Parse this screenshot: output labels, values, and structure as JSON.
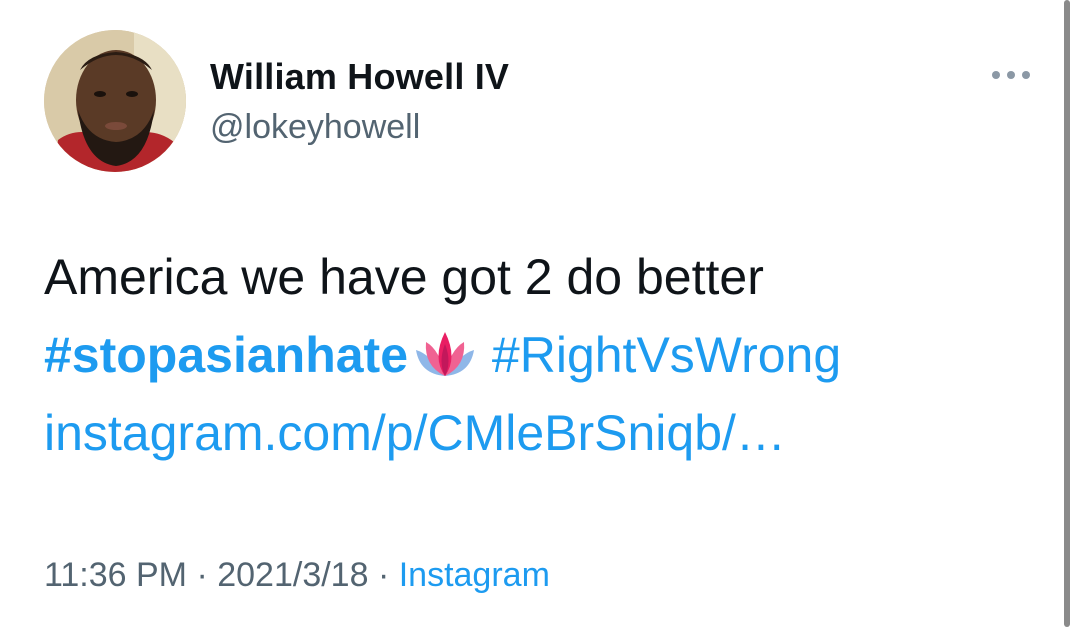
{
  "tweet": {
    "author": {
      "display_name": "William Howell IV",
      "handle": "@lokeyhowell"
    },
    "more_icon": "more-horizontal-icon",
    "body": {
      "text": "America we have got 2 do better",
      "hashtag_1": "#stopasianhate",
      "emoji": "lotus-emoji",
      "hashtag_2": "#RightVsWrong",
      "link": "instagram.com/p/CMleBrSniqb/…"
    },
    "meta": {
      "time": "11:36 PM",
      "separator": " · ",
      "date": "2021/3/18",
      "source": "Instagram"
    },
    "colors": {
      "link": "#1d9bf0",
      "secondary_text": "#536471",
      "primary_text": "#0f1419"
    }
  }
}
